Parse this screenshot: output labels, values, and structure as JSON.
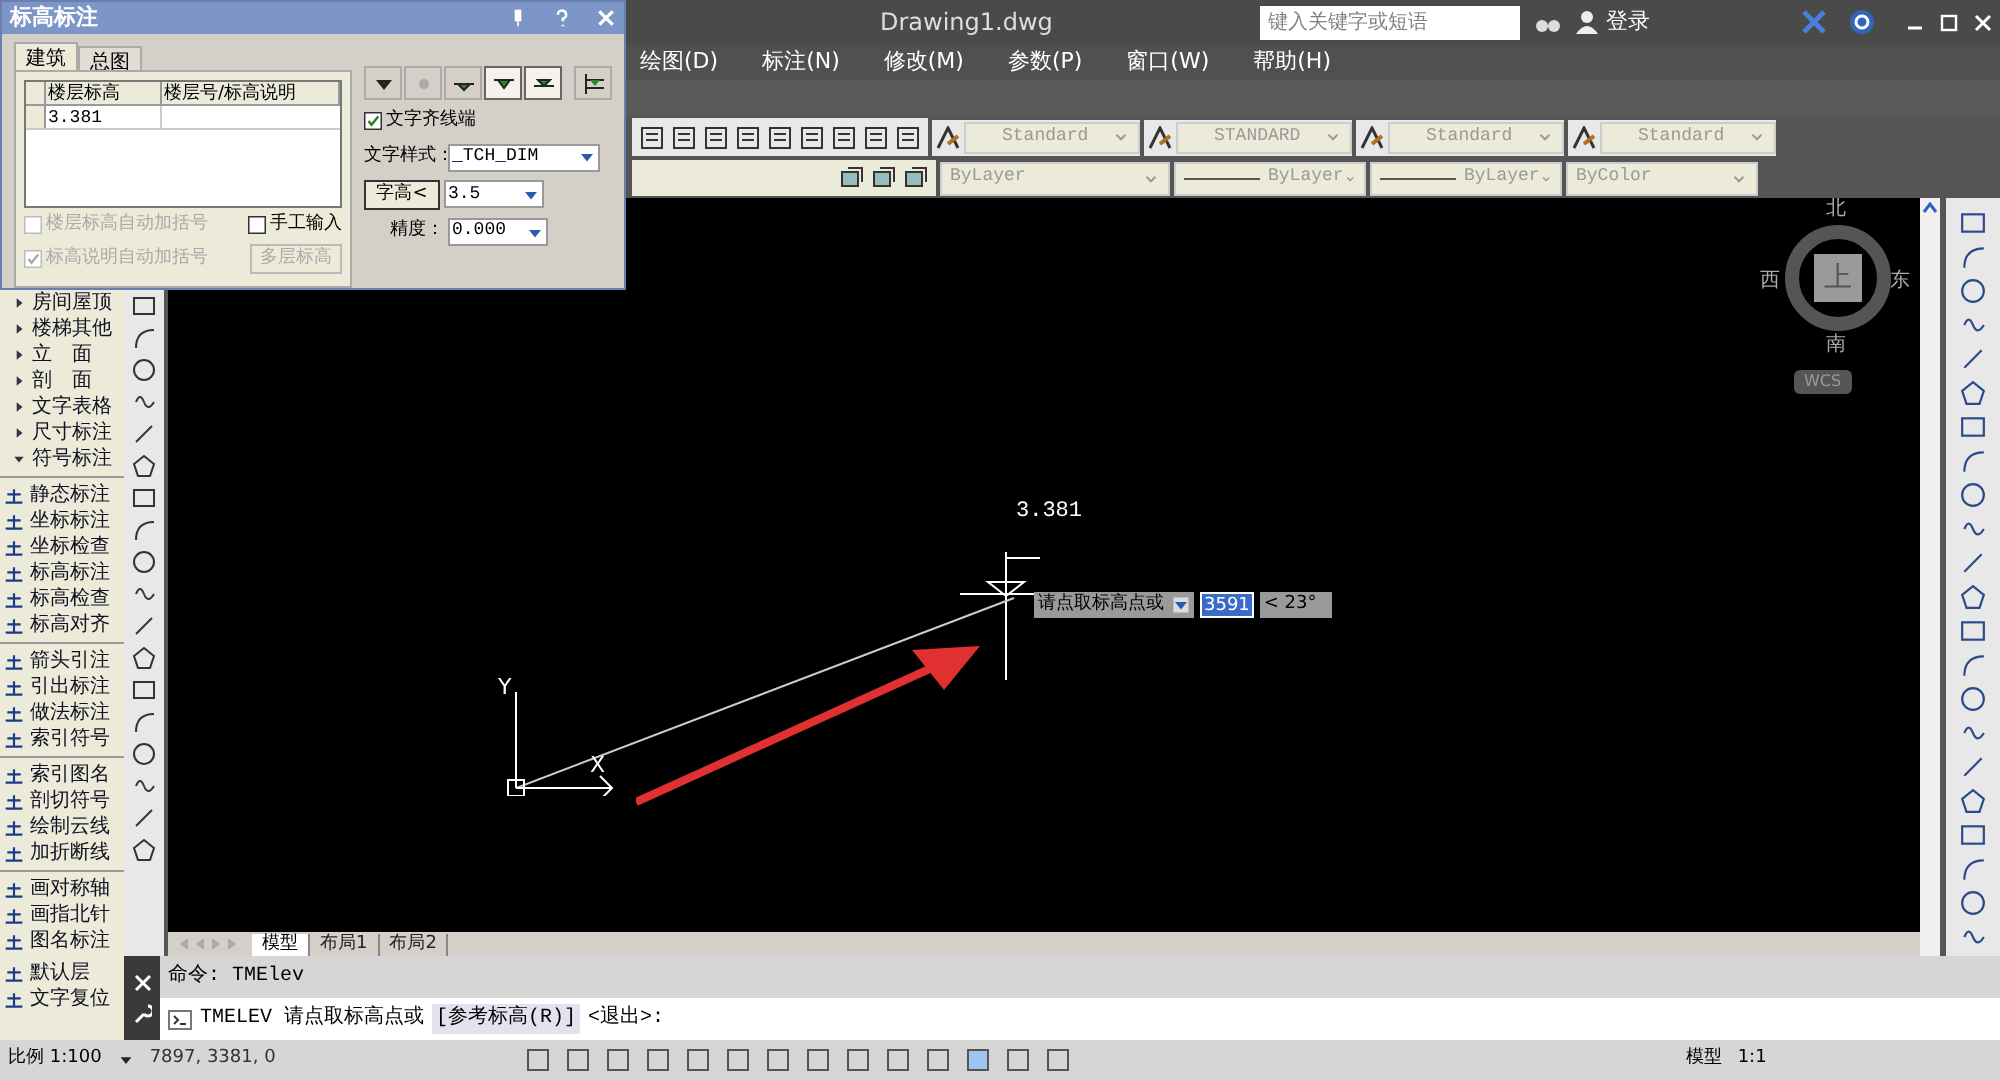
{
  "window": {
    "title": "Drawing1.dwg",
    "search": {
      "placeholder": "键入关键字或短语"
    },
    "sign_in": "登录"
  },
  "menu": [
    "绘图(D)",
    "标注(N)",
    "修改(M)",
    "参数(P)",
    "窗口(W)",
    "帮助(H)"
  ],
  "style_toolbar": [
    "Standard",
    "STANDARD",
    "Standard",
    "Standard"
  ],
  "layer_toolbar": [
    "ByLayer",
    "ByLayer",
    "ByLayer",
    "ByColor"
  ],
  "palette": {
    "categories": [
      {
        "label": "房间屋顶",
        "expanded": false
      },
      {
        "label": "楼梯其他",
        "expanded": false
      },
      {
        "label": "立　面",
        "expanded": false
      },
      {
        "label": "剖　面",
        "expanded": false
      },
      {
        "label": "文字表格",
        "expanded": false
      },
      {
        "label": "尺寸标注",
        "expanded": false
      },
      {
        "label": "符号标注",
        "expanded": true
      }
    ],
    "groups": [
      [
        "静态标注",
        "坐标标注",
        "坐标检查",
        "标高标注",
        "标高检查",
        "标高对齐"
      ],
      [
        "箭头引注",
        "引出标注",
        "做法标注",
        "索引符号"
      ],
      [
        "索引图名",
        "剖切符号",
        "绘制云线",
        "加折断线"
      ],
      [
        "画对称轴",
        "画指北针",
        "图名标注"
      ],
      [
        "默认层",
        "文字复位"
      ]
    ]
  },
  "drawing": {
    "elevation_text": "3.381",
    "ucs_x": "X",
    "ucs_y": "Y",
    "tooltip": {
      "prompt": "请点取标高点或",
      "value": "3591",
      "angle": "< 23°"
    }
  },
  "viewcube": {
    "north": "北",
    "south": "南",
    "east": "东",
    "west": "西",
    "face": "上",
    "ucs": "WCS"
  },
  "layout_tabs": [
    {
      "label": "模型",
      "selected": true
    },
    {
      "label": "布局1",
      "selected": false
    },
    {
      "label": "布局2",
      "selected": false
    }
  ],
  "command_line": {
    "history": "命令: TMElev",
    "prompt": "TMELEV 请点取标高点或",
    "option": "[参考标高(R)]",
    "tail": "<退出>:"
  },
  "status_bar": {
    "scale": "比例 1:100",
    "coordinates": "7897, 3381, 0",
    "model": "模型",
    "annotation_scale": "1:1"
  },
  "dialog": {
    "title": "标高标注",
    "tabs": [
      {
        "label": "建筑",
        "selected": true
      },
      {
        "label": "总图",
        "selected": false
      }
    ],
    "table": {
      "columns": [
        "楼层标高",
        "楼层号/标高说明"
      ],
      "rows": [
        {
          "elevation": "3.381"
        }
      ]
    },
    "options": [
      {
        "label": "楼层标高自动加括号",
        "checked": false,
        "disabled": true
      },
      {
        "label": "标高说明自动加括号",
        "checked": true,
        "disabled": true
      }
    ],
    "manual_input": {
      "label": "手工输入",
      "checked": false
    },
    "multi_button": {
      "label": "多层标高",
      "disabled": true
    },
    "symbols": [
      {
        "selected": false
      },
      {
        "selected": false
      },
      {
        "selected": false
      },
      {
        "selected": true
      },
      {
        "selected": true
      },
      {
        "selected": false
      }
    ],
    "align_text": {
      "label": "文字齐线端",
      "checked": true
    },
    "text_style": {
      "label": "文字样式：",
      "value": "_TCH_DIM"
    },
    "text_height": {
      "button": "字高<",
      "value": "3.5"
    },
    "precision": {
      "label": "精度：",
      "value": "0.000"
    }
  }
}
